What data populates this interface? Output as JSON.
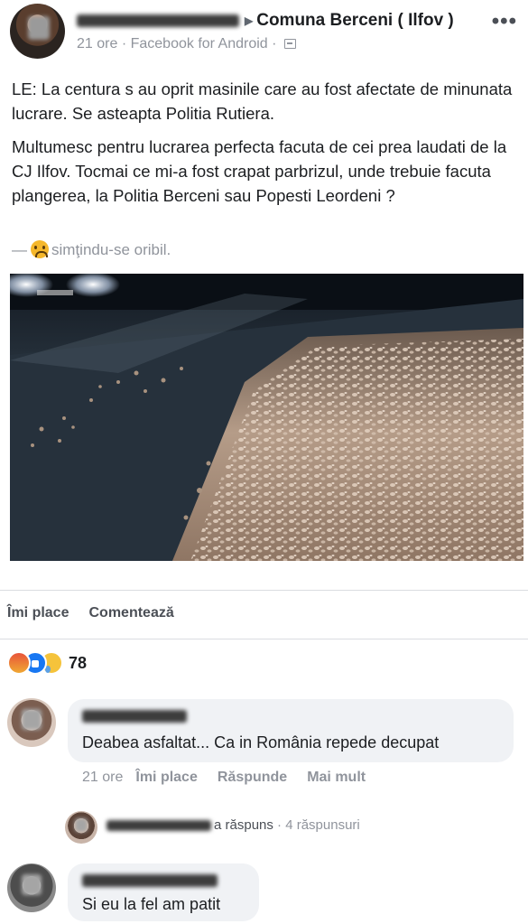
{
  "post": {
    "group_name": "Comuna Berceni ( Ilfov )",
    "time": "21 ore",
    "separator": "·",
    "source": "Facebook for Android ·",
    "paragraph1": "LE: La centura s au oprit masinile care au fost afectate de minunata lucrare. Se asteapta Politia Rutiera.",
    "paragraph2": "Multumesc pentru lucrarea perfecta facuta de cei prea laudati de la CJ Ilfov. Tocmai ce mi-a fost crapat parbrizul, unde trebuie facuta plangerea, la Politia Berceni sau Popesti Leordeni ?",
    "feeling_dash": "—",
    "feeling": "simţindu-se oribil.",
    "icons": {
      "more": "more-dots-icon",
      "privacy": "globe-icon",
      "feeling": "sad-face-icon"
    }
  },
  "actions": {
    "like": "Îmi place",
    "comment": "Comentează"
  },
  "reactions": {
    "count": "78",
    "types": [
      "angry",
      "like",
      "sad"
    ]
  },
  "comments": [
    {
      "text": "Deabea asfaltat... Ca in România repede decupat",
      "time": "21 ore",
      "like": "Îmi place",
      "reply": "Răspunde",
      "more": "Mai mult"
    }
  ],
  "reply_summary": {
    "replied": "a răspuns",
    "count": "· 4 răspunsuri"
  },
  "second_comment": {
    "text": "Si eu la fel am patit"
  },
  "colors": {
    "text": "#1c1e21",
    "meta": "#90949c",
    "bubble": "#f0f2f5",
    "like_blue": "#1877f2"
  }
}
